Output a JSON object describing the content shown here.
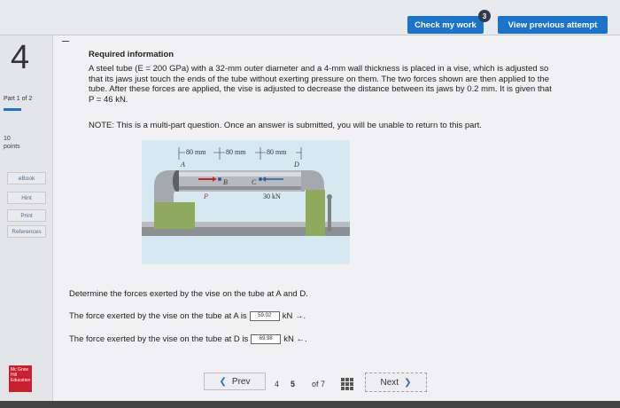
{
  "header": {
    "check_label": "Check my work",
    "check_badge": "3",
    "view_previous_label": "View previous attempt"
  },
  "sidebar": {
    "question_number": "4",
    "part_label": "Part 1 of 2",
    "points_value": "10",
    "points_label": "points",
    "links": [
      "eBook",
      "Hint",
      "Print",
      "References"
    ],
    "logo_text": "Mc Graw Hill Education"
  },
  "content": {
    "heading": "Required information",
    "paragraph": "A steel tube (E = 200 GPa) with a 32-mm outer diameter and a 4-mm wall thickness is placed in a vise, which is adjusted so that its jaws just touch the ends of the tube without exerting pressure on them. The two forces shown are then applied to the tube. After these forces are applied, the vise is adjusted to decrease the distance between its jaws by 0.2 mm. It is given that P = 46 kN.",
    "note": "NOTE: This is a multi-part question. Once an answer is submitted, you will be unable to return to this part.",
    "question": "Determine the forces exerted by the vise on the tube at A and D.",
    "answer_a_prefix": "The force exerted by the vise on the tube at A is",
    "answer_a_value": "59.02",
    "answer_a_suffix": "kN →.",
    "answer_d_prefix": "The force exerted by the vise on the tube at D is",
    "answer_d_value": "69.98",
    "answer_d_suffix": "kN ←."
  },
  "figure": {
    "dim1": "80 mm",
    "dim2": "80 mm",
    "dim3": "80 mm",
    "label_a": "A",
    "label_b": "B",
    "label_c": "C",
    "label_d": "D",
    "label_p": "P",
    "force_label": "30 kN"
  },
  "pager": {
    "prev_label": "Prev",
    "page_prev": "4",
    "page_current": "5",
    "of_label": "of 7",
    "next_label": "Next"
  },
  "colors": {
    "accent": "#1b74c9",
    "brand": "#c8202f",
    "figure_bg": "#d6e8f2"
  }
}
